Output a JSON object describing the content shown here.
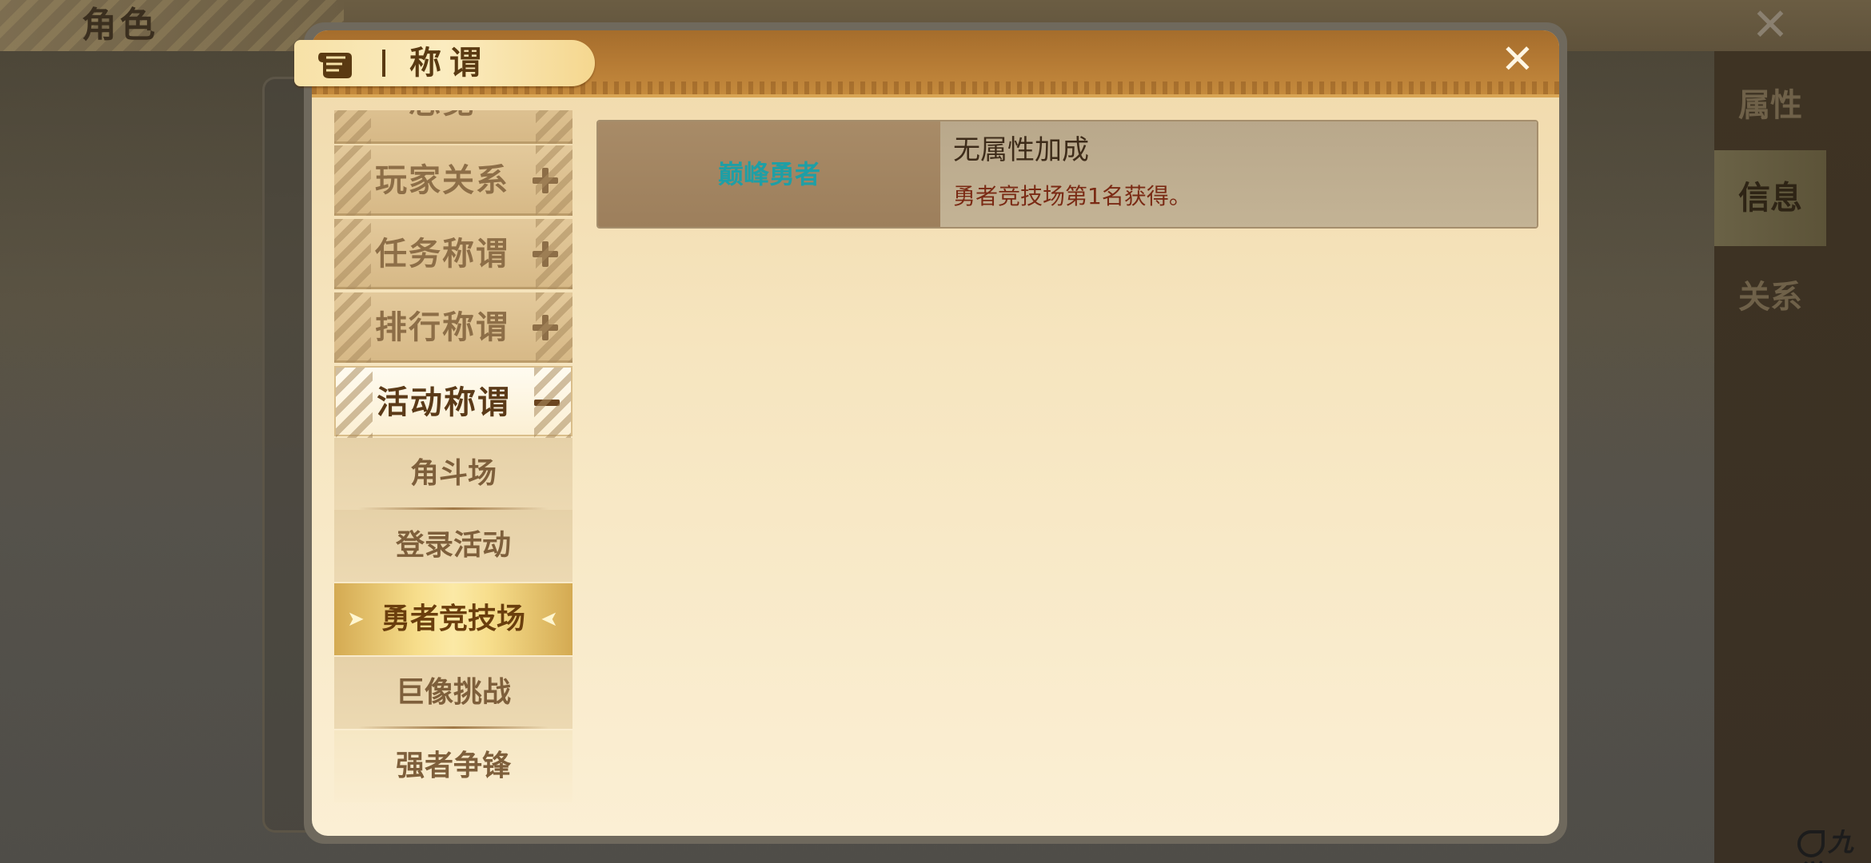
{
  "background": {
    "screen_title": "角色",
    "side_tabs": [
      "属性",
      "信息",
      "关系"
    ],
    "active_side_tab": "信息"
  },
  "modal": {
    "title": "称谓",
    "title_icon": "scroll-icon",
    "close_icon": "close-icon"
  },
  "categories": {
    "partial_top": "总览",
    "items": [
      {
        "label": "玩家关系",
        "state": "collapsed"
      },
      {
        "label": "任务称谓",
        "state": "collapsed"
      },
      {
        "label": "排行称谓",
        "state": "collapsed"
      },
      {
        "label": "活动称谓",
        "state": "expanded"
      }
    ],
    "subitems": [
      {
        "label": "角斗场",
        "selected": false
      },
      {
        "label": "登录活动",
        "selected": false
      },
      {
        "label": "勇者竞技场",
        "selected": true
      },
      {
        "label": "巨像挑战",
        "selected": false
      },
      {
        "label": "强者争锋",
        "selected": false
      }
    ]
  },
  "titles": [
    {
      "name": "巅峰勇者",
      "attribute": "无属性加成",
      "source": "勇者竞技场第1名获得。"
    }
  ],
  "watermark": "九游",
  "colors": {
    "header": "#b77c35",
    "title_name": "#1e9fa6",
    "source_text": "#7a2a14",
    "selected_gold": "#f7de8c"
  }
}
